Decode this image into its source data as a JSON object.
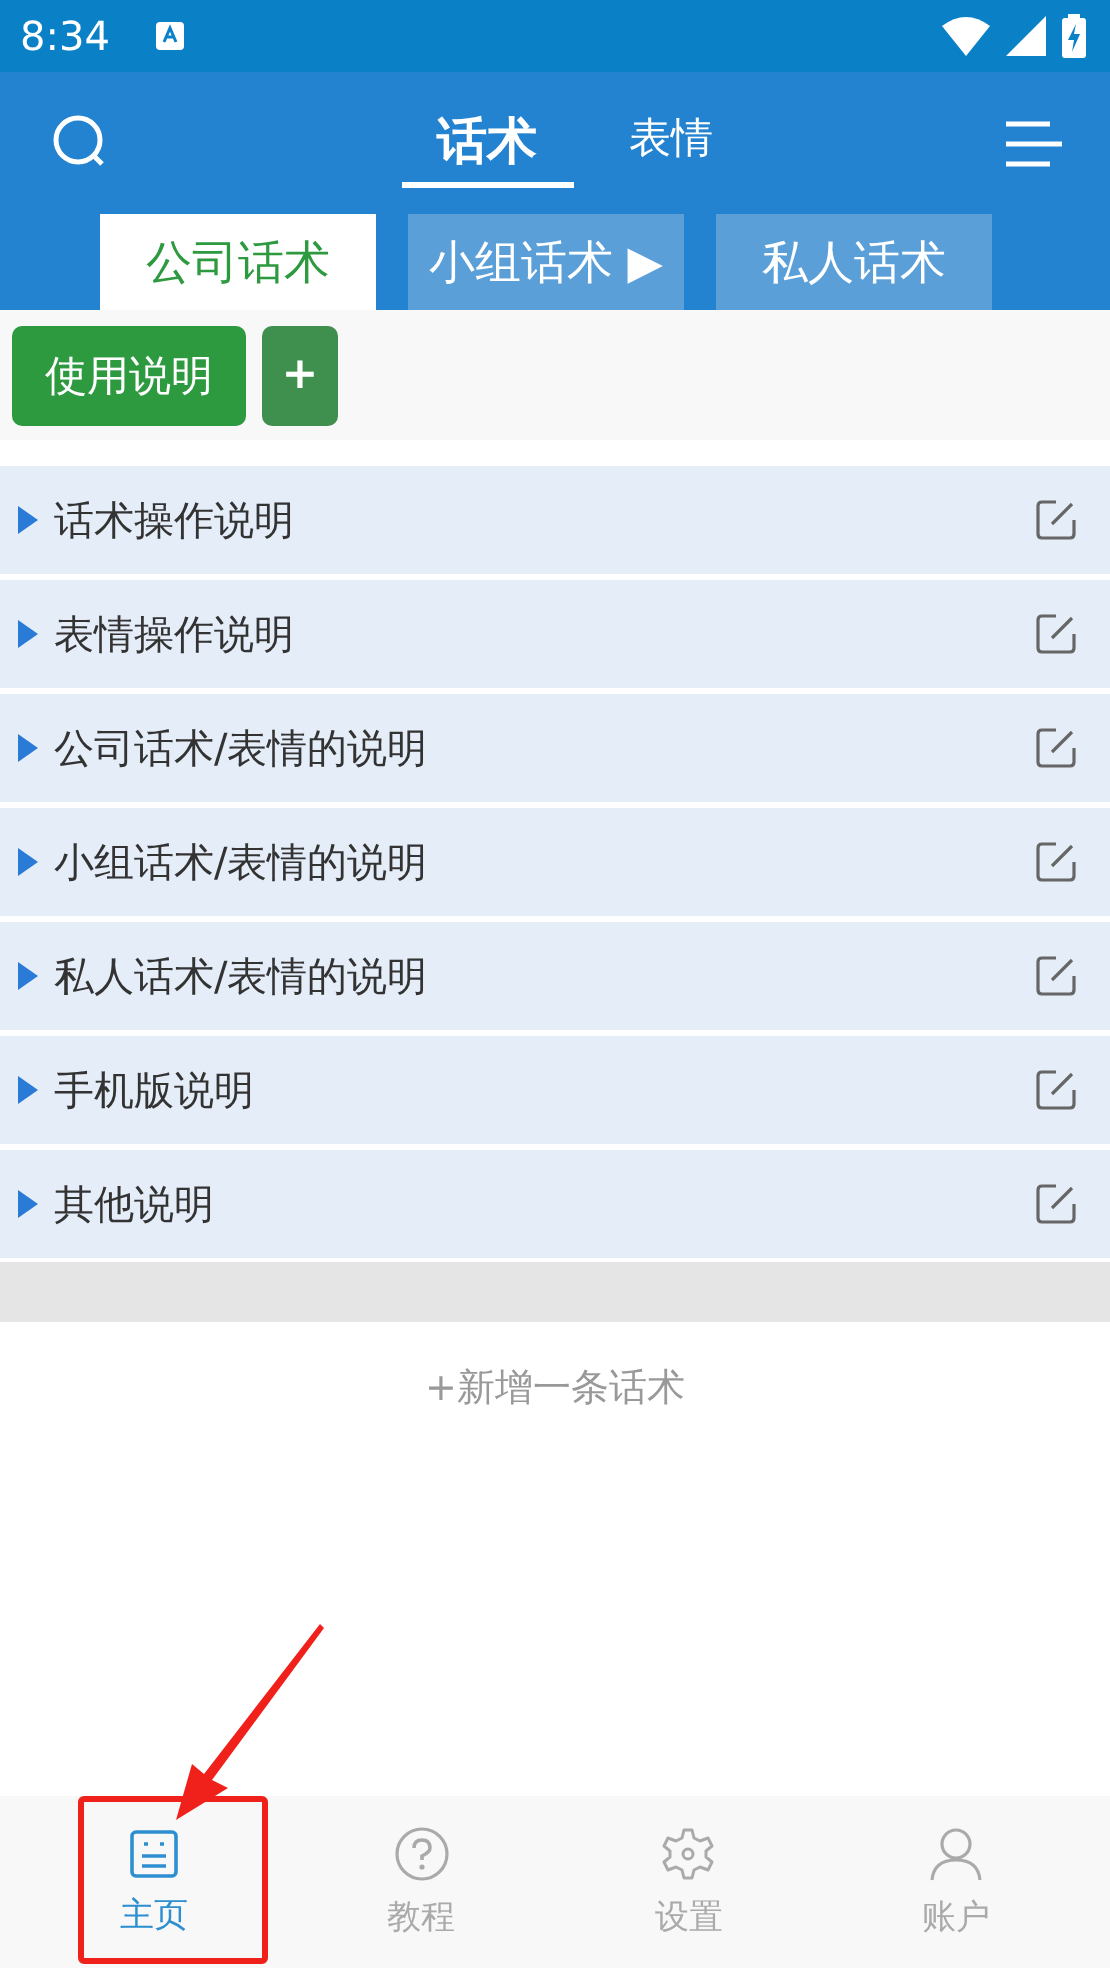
{
  "status_bar": {
    "time": "8:34"
  },
  "top_tabs": [
    {
      "label": "话术",
      "selected": true
    },
    {
      "label": "表情",
      "selected": false
    }
  ],
  "sub_tabs": [
    {
      "label": "公司话术",
      "selected": true
    },
    {
      "label": "小组话术 ▶",
      "selected": false
    },
    {
      "label": "私人话术",
      "selected": false
    }
  ],
  "toolbar": {
    "buttons": [
      {
        "label": "使用说明",
        "kind": "primary"
      },
      {
        "label": "+",
        "kind": "add"
      }
    ]
  },
  "items": [
    {
      "title": "话术操作说明"
    },
    {
      "title": "表情操作说明"
    },
    {
      "title": "公司话术/表情的说明"
    },
    {
      "title": "小组话术/表情的说明"
    },
    {
      "title": "私人话术/表情的说明"
    },
    {
      "title": "手机版说明"
    },
    {
      "title": "其他说明"
    }
  ],
  "add_link": "+新增一条话术",
  "bottom_nav": [
    {
      "label": "主页",
      "kind": "home",
      "selected": true,
      "highlighted": true
    },
    {
      "label": "教程",
      "kind": "help",
      "selected": false,
      "highlighted": false
    },
    {
      "label": "设置",
      "kind": "settings",
      "selected": false,
      "highlighted": false
    },
    {
      "label": "账户",
      "kind": "account",
      "selected": false,
      "highlighted": false
    }
  ]
}
